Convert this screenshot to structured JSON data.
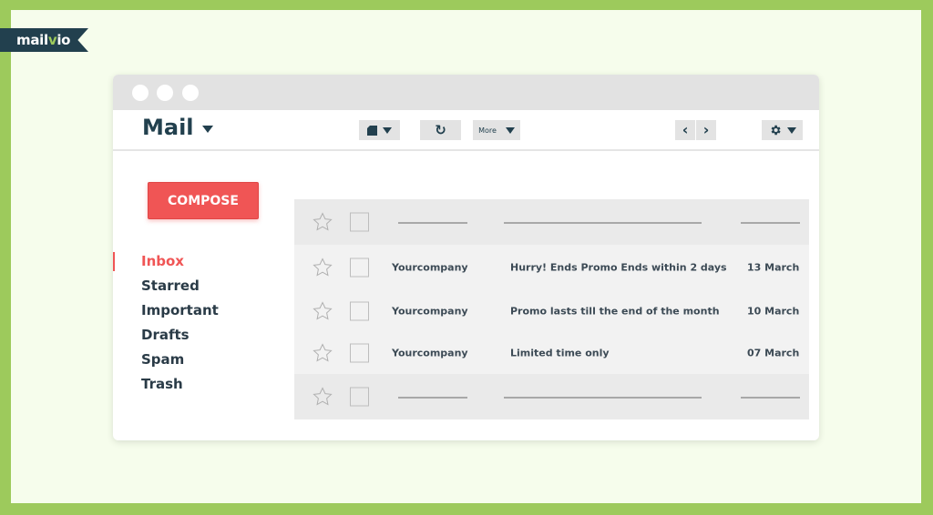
{
  "brand": {
    "logo_text_a": "mail",
    "logo_text_v": "v",
    "logo_text_b": "io",
    "accent": "#9dca5c",
    "ribbon_color": "#22404e"
  },
  "header": {
    "title": "Mail"
  },
  "toolbar": {
    "more_label": "More",
    "refresh_glyph": "↻",
    "prev_glyph": "‹",
    "next_glyph": "›"
  },
  "compose_label": "COMPOSE",
  "sidebar": {
    "items": [
      {
        "label": "Inbox",
        "active": true
      },
      {
        "label": "Starred"
      },
      {
        "label": "Important"
      },
      {
        "label": "Drafts"
      },
      {
        "label": "Spam"
      },
      {
        "label": "Trash"
      }
    ]
  },
  "emails": [
    {
      "sender": "Yourcompany",
      "subject": "Hurry! Ends Promo Ends within 2 days",
      "date": "13 March"
    },
    {
      "sender": "Yourcompany",
      "subject": "Promo lasts till the end of the month",
      "date": "10 March"
    },
    {
      "sender": "Yourcompany",
      "subject": "Limited time only",
      "date": "07 March"
    }
  ],
  "colors": {
    "compose": "#f05555",
    "active_nav": "#f05555",
    "text_dark": "#22404e"
  }
}
